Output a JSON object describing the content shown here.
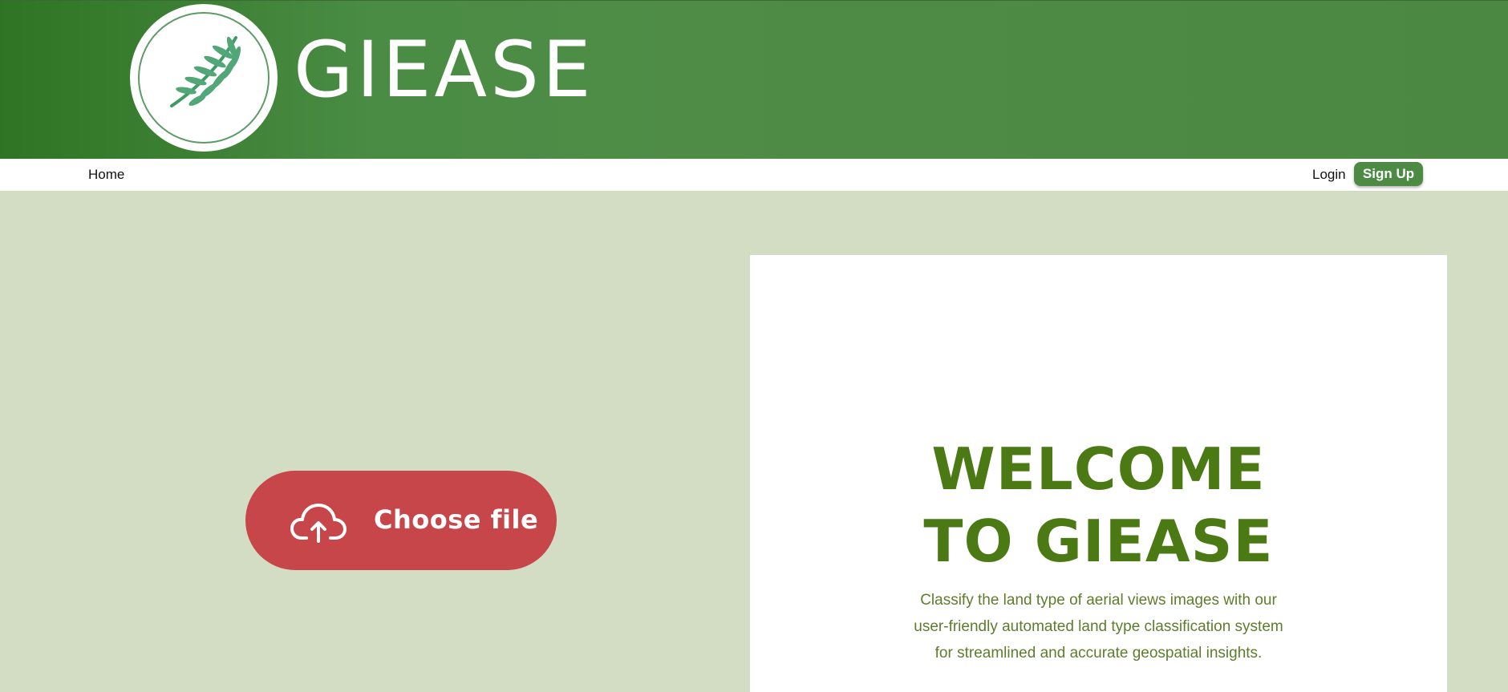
{
  "header": {
    "brand": "GIEASE",
    "logo_icon": "palm-leaf-icon"
  },
  "nav": {
    "home_label": "Home",
    "login_label": "Login",
    "signup_label": "Sign Up"
  },
  "upload": {
    "button_label": "Choose file",
    "icon": "cloud-upload-icon"
  },
  "welcome": {
    "title_line1": "WELCOME",
    "title_line2": "TO GIEASE",
    "description": "Classify the land type of aerial views images with our user-friendly automated land type classification system for streamlined and accurate geospatial insights."
  },
  "colors": {
    "header_green": "#4a8c44",
    "background": "#d2ddc3",
    "signup_green": "#4d8b45",
    "upload_red": "#c7464a",
    "title_green": "#4b7a14"
  }
}
